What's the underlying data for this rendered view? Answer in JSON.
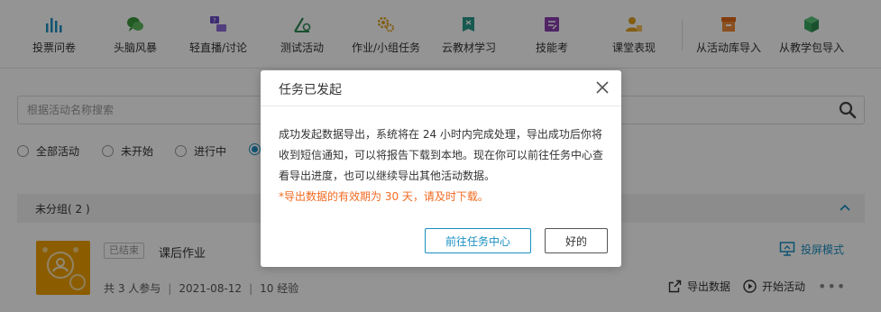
{
  "toolbar": {
    "items": [
      {
        "label": "投票问卷",
        "icon": "bar-chart-icon",
        "color": "#1a8fc2"
      },
      {
        "label": "头脑风暴",
        "icon": "speech-bubbles-icon",
        "color": "#3c9a3c"
      },
      {
        "label": "轻直播/讨论",
        "icon": "live-chat-icon",
        "color": "#6a4bc4"
      },
      {
        "label": "测试活动",
        "icon": "quiz-icon",
        "color": "#2e8b57"
      },
      {
        "label": "作业/小组任务",
        "icon": "gears-icon",
        "color": "#e0a020"
      },
      {
        "label": "云教材学习",
        "icon": "book-icon",
        "color": "#2a9a8a"
      },
      {
        "label": "技能考",
        "icon": "skill-icon",
        "color": "#8a3fb0"
      },
      {
        "label": "课堂表现",
        "icon": "performance-icon",
        "color": "#e0a020"
      },
      {
        "label": "从活动库导入",
        "icon": "archive-icon",
        "color": "#e06a1a"
      },
      {
        "label": "从教学包导入",
        "icon": "package-icon",
        "color": "#3aa860"
      }
    ]
  },
  "search": {
    "placeholder": "根据活动名称搜索"
  },
  "filters": [
    {
      "label": "全部活动",
      "checked": false
    },
    {
      "label": "未开始",
      "checked": false
    },
    {
      "label": "进行中",
      "checked": false
    },
    {
      "label": "",
      "checked": true
    }
  ],
  "group": {
    "title": "未分组( 2 )"
  },
  "activity": {
    "status": "已结束",
    "title": "课后作业",
    "participants": "共 3 人参与",
    "date": "2021-08-12",
    "exp": "10 经验",
    "screen_mode": "投屏模式",
    "export": "导出数据",
    "start": "开始活动",
    "more": "•••"
  },
  "dialog": {
    "title": "任务已发起",
    "body": "成功发起数据导出，系统将在 24 小时内完成处理，导出成功后你将收到短信通知，可以将报告下载到本地。现在你可以前往任务中心查看导出进度，也可以继续导出其他活动数据。",
    "warning": "*导出数据的有效期为 30 天，请及时下载。",
    "primary_button": "前往任务中心",
    "ok_button": "好的"
  },
  "colors": {
    "accent": "#1a8fc2",
    "warning": "#f26a21",
    "thumb": "#f0a000"
  }
}
